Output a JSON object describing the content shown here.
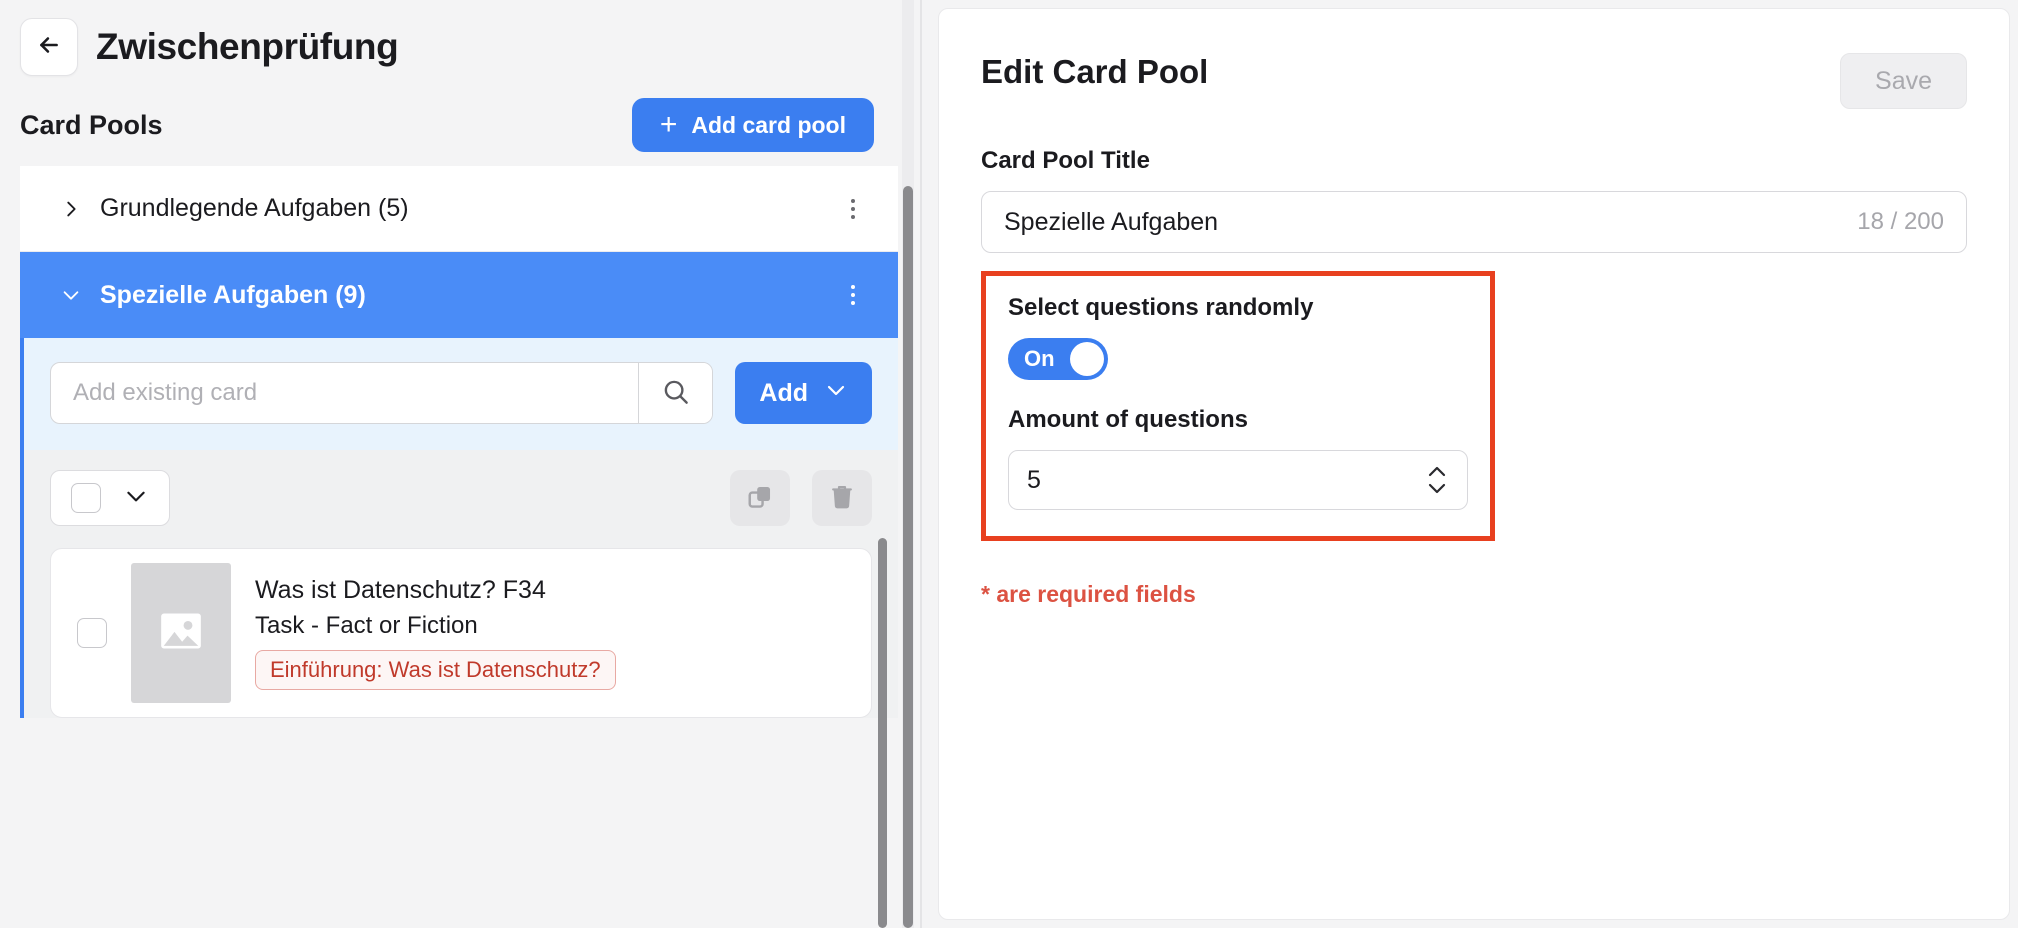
{
  "left": {
    "back_icon": "arrow-left-icon",
    "page_title": "Zwischenprüfung",
    "section_label": "Card Pools",
    "add_pool_button": "Add card pool",
    "add_pool_plus": "+",
    "pools": [
      {
        "name": "Grundlegende Aufgaben (5)",
        "expanded": false,
        "chevron": "chevron-right-icon"
      },
      {
        "name": "Spezielle Aufgaben (9)",
        "expanded": true,
        "chevron": "chevron-down-icon"
      }
    ],
    "search": {
      "placeholder": "Add existing card",
      "value": "",
      "search_icon": "search-icon"
    },
    "add_button": {
      "label": "Add",
      "chevron": "chevron-down-icon"
    },
    "bulk": {
      "select_all_checkbox": "checkbox",
      "dropdown_chevron": "chevron-down-icon",
      "copy_icon": "copy-icon",
      "delete_icon": "trash-icon"
    },
    "cards": [
      {
        "checkbox": "checkbox",
        "thumbnail_icon": "image-placeholder-icon",
        "title": "Was ist Datenschutz? F34",
        "subtitle": "Task - Fact or Fiction",
        "tag": "Einführung: Was ist Datenschutz?"
      }
    ]
  },
  "right": {
    "title": "Edit Card Pool",
    "save_label": "Save",
    "card_pool_title_label": "Card Pool Title",
    "card_pool_title_value": "Spezielle Aufgaben",
    "card_pool_title_placeholder": "Card Pool Title",
    "char_count": "18 / 200",
    "random_label": "Select questions randomly",
    "toggle_state": "On",
    "amount_label": "Amount of questions",
    "amount_value": "5",
    "required_note": "* are required fields"
  },
  "colors": {
    "accent_blue": "#3b7ef0",
    "active_row_blue": "#4a8cf7",
    "highlight_red": "#e8401f",
    "required_red": "#dc5242",
    "tag_red": "#c03a2b"
  }
}
